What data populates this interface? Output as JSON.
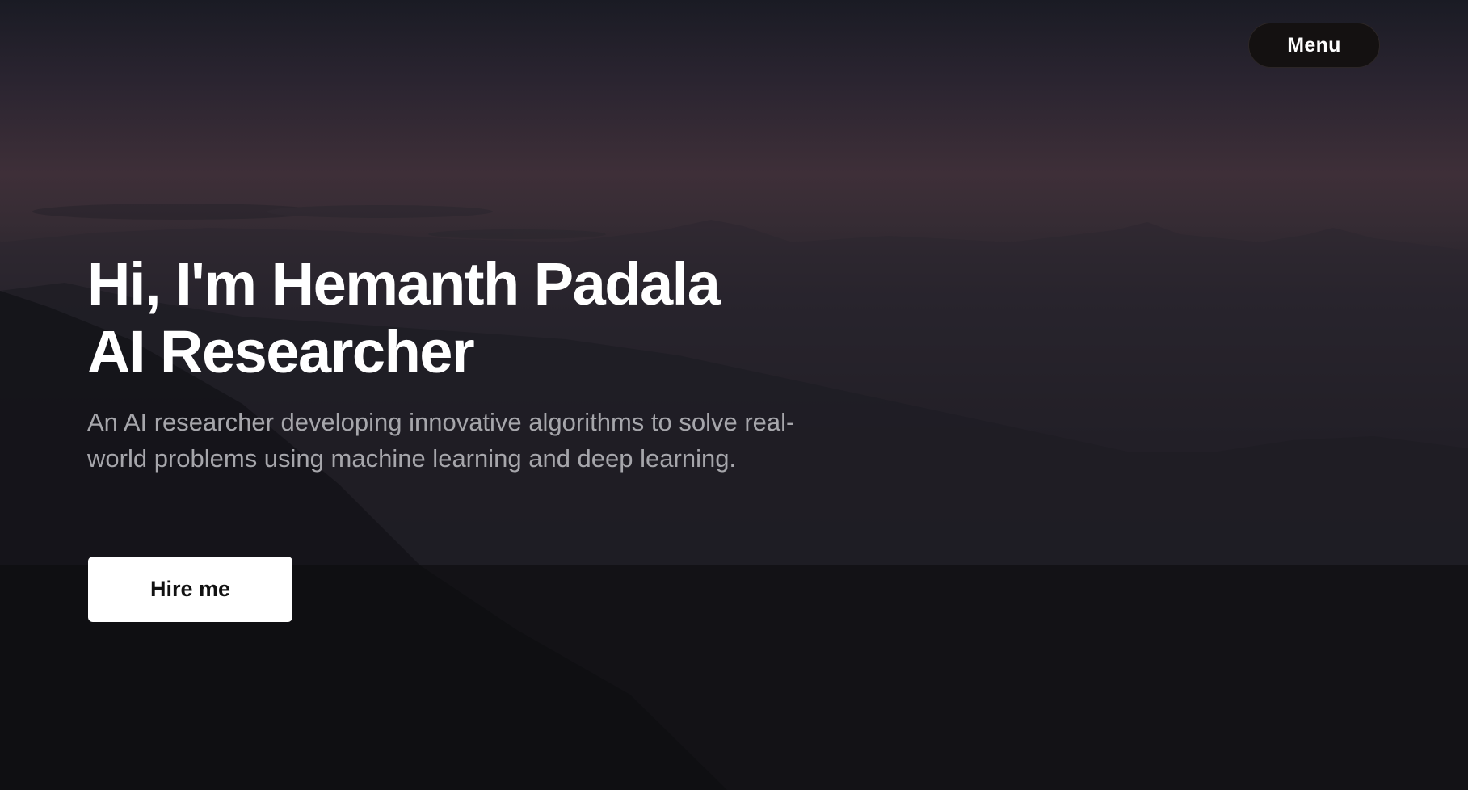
{
  "nav": {
    "menu_label": "Menu"
  },
  "hero": {
    "headline_line1": "Hi, I'm Hemanth Padala",
    "headline_line2": "AI Researcher",
    "subtitle": "An AI researcher developing innovative algorithms to solve real-world problems using machine learning and deep learning.",
    "cta_label": "Hire me"
  },
  "colors": {
    "accent_button": "#ffffff",
    "menu_button": "#141111",
    "headline_text": "#ffffff",
    "subtitle_text": "#a6a6ab"
  }
}
